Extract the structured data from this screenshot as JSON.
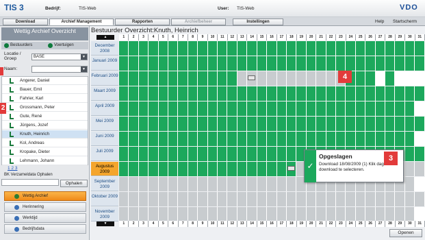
{
  "app": {
    "title": "TIS 3",
    "logo": "VDO"
  },
  "topbar": {
    "company_label": "Bedrijf:",
    "company_value": "TIS-Web",
    "user_label": "User:",
    "user_value": "TIS-Web"
  },
  "nav": {
    "tabs": [
      "Download",
      "Archief Management",
      "Rapporten",
      "Archiefbeheer",
      "Instellingen"
    ],
    "help": "Help",
    "start": "Startscherm"
  },
  "sidebar": {
    "title": "Wettig Archief Overzicht",
    "tab_drivers": "Bestuurders",
    "tab_vehicles": "Voertuigen",
    "location_label": "Locatie / Groep",
    "location_value": "BASE",
    "name_label": "Naam:",
    "name_value": "",
    "drivers": [
      "Angerer, Daniel",
      "Bauer, Emil",
      "Fahrier, Karl",
      "Grossmann, Peter",
      "Gute, René",
      "Jürgens, Jozef",
      "Knuth, Heinrich",
      "Kol, Andreas",
      "Kropake, Dieter",
      "Lehmann, Johann"
    ],
    "pager": "1 2 3",
    "bk_label": "BK Verzameldata Ophalen",
    "bk_button": "Ophalen",
    "menu": [
      "Wettig Archief",
      "Herinnering",
      "Werktijd",
      "Bedrijfsdata"
    ]
  },
  "main": {
    "title": "Bestuurder Overzicht:Knuth, Heinrich",
    "open_button": "Openen"
  },
  "grid": {
    "days": [
      "1",
      "2",
      "3",
      "4",
      "5",
      "6",
      "7",
      "8",
      "9",
      "10",
      "11",
      "12",
      "13",
      "14",
      "15",
      "16",
      "17",
      "18",
      "19",
      "20",
      "21",
      "22",
      "23",
      "24",
      "25",
      "26",
      "27",
      "28",
      "29",
      "30",
      "31"
    ],
    "months": [
      {
        "label": "December 2008",
        "status": "GGGGGGGGGGGGGGGGGGGGGGGGGGGGGGG"
      },
      {
        "label": "Januari 2009",
        "status": "GGGGGGGGGGGGGGGGGGGGGGGGGGGGGGG"
      },
      {
        "label": "Februari 2009",
        "status": "GGGGGGGGGGGGXXXXXXXXXXXGGGWGWWW"
      },
      {
        "label": "Maart 2009",
        "status": "GGGGGGGGGGGGGGGGGGGGGGGGGGGGGGG"
      },
      {
        "label": "April 2009",
        "status": "GGGGGGGGGGGGGGGGGGGGGGGGGGGGGGW"
      },
      {
        "label": "Mei 2009",
        "status": "GGGGGGGGGGGGGGGGGGGGGGGGGGGGGGG"
      },
      {
        "label": "Juni 2009",
        "status": "GGGGGGGGGGGGGGGGGGGGGGGGGGGGGGW"
      },
      {
        "label": "Juli 2009",
        "status": "GGGGGGGGGGGGGGGGGGGGGGGGGGGGGGG"
      },
      {
        "label": "Augustus 2009",
        "status": "GGGGGGGGGGGGGGGGGGXXXXXXXXXXXXX"
      },
      {
        "label": "September 2009",
        "status": "XXXXXXXXXXXXXXXXXXXXXXXXXXXXXXW"
      },
      {
        "label": "Oktober 2009",
        "status": "XXXXXXXXXXXXXXXXXXXXXXXXXXXXXXX"
      },
      {
        "label": "November 2009",
        "status": "XXXXXXXXXXXXXXXXXXXXXXXXXXXXXXW"
      }
    ],
    "current_month_index": 8,
    "download_icons": [
      {
        "month": 2,
        "day": 14
      },
      {
        "month": 8,
        "day": 18
      }
    ]
  },
  "popup": {
    "title": "Opgeslagen",
    "text": "Download 18/08/2009 (1) Klik dag om download te selecteren."
  },
  "badges": {
    "b2": "2",
    "b3": "3",
    "b4": "4"
  },
  "colors": {
    "recorded": "#1ca85c",
    "missing": "#c8cccf",
    "accent": "#f08a1a",
    "marker": "#e23b3b"
  }
}
